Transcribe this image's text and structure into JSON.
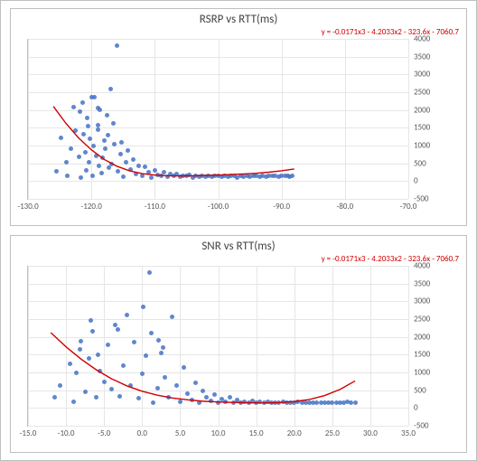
{
  "chart_data": [
    {
      "type": "scatter",
      "title": "RSRP vs RTT(ms)",
      "equation": "y = -0.0171x3 - 4.2033x2 - 323.6x - 7060.7",
      "xlabel": "",
      "ylabel": "",
      "xlim": [
        -130.0,
        -70.0
      ],
      "ylim": [
        -500,
        4000
      ],
      "xticks": [
        -130.0,
        -120.0,
        -110.0,
        -100.0,
        -90.0,
        -80.0,
        -70.0
      ],
      "yticks": [
        -500,
        0,
        500,
        1000,
        1500,
        2000,
        2500,
        3000,
        3500,
        4000
      ],
      "points": [
        [
          -125.5,
          280
        ],
        [
          -124.0,
          520
        ],
        [
          -124.8,
          1210
        ],
        [
          -123.8,
          160
        ],
        [
          -123.2,
          900
        ],
        [
          -122.5,
          1420
        ],
        [
          -122.0,
          680
        ],
        [
          -121.8,
          1950
        ],
        [
          -121.6,
          110
        ],
        [
          -121.2,
          1320
        ],
        [
          -121.0,
          820
        ],
        [
          -120.8,
          310
        ],
        [
          -120.6,
          1780
        ],
        [
          -120.4,
          520
        ],
        [
          -120.2,
          1180
        ],
        [
          -120.0,
          2350
        ],
        [
          -119.8,
          140
        ],
        [
          -119.6,
          980
        ],
        [
          -119.2,
          700
        ],
        [
          -119.0,
          1450
        ],
        [
          -118.8,
          430
        ],
        [
          -118.6,
          2000
        ],
        [
          -118.4,
          230
        ],
        [
          -118.2,
          660
        ],
        [
          -118.0,
          1150
        ],
        [
          -117.8,
          900
        ],
        [
          -117.6,
          1850
        ],
        [
          -117.2,
          380
        ],
        [
          -117.0,
          2600
        ],
        [
          -116.8,
          480
        ],
        [
          -116.4,
          1040
        ],
        [
          -116.0,
          3820
        ],
        [
          -115.8,
          280
        ],
        [
          -115.4,
          760
        ],
        [
          -115.0,
          120
        ],
        [
          -114.6,
          520
        ],
        [
          -114.2,
          870
        ],
        [
          -113.8,
          330
        ],
        [
          -113.4,
          600
        ],
        [
          -113.0,
          190
        ],
        [
          -112.5,
          420
        ],
        [
          -112.0,
          150
        ],
        [
          -111.5,
          390
        ],
        [
          -111.0,
          250
        ],
        [
          -110.5,
          110
        ],
        [
          -110.0,
          310
        ],
        [
          -109.5,
          180
        ],
        [
          -109.0,
          140
        ],
        [
          -108.5,
          250
        ],
        [
          -108.0,
          130
        ],
        [
          -107.5,
          210
        ],
        [
          -107.0,
          150
        ],
        [
          -106.5,
          190
        ],
        [
          -106.0,
          120
        ],
        [
          -105.5,
          160
        ],
        [
          -105.0,
          140
        ],
        [
          -104.5,
          170
        ],
        [
          -104.0,
          110
        ],
        [
          -103.5,
          150
        ],
        [
          -103.0,
          130
        ],
        [
          -102.5,
          160
        ],
        [
          -102.0,
          120
        ],
        [
          -101.5,
          150
        ],
        [
          -101.0,
          130
        ],
        [
          -100.5,
          140
        ],
        [
          -100.0,
          150
        ],
        [
          -99.5,
          120
        ],
        [
          -99.0,
          150
        ],
        [
          -98.5,
          130
        ],
        [
          -98.0,
          160
        ],
        [
          -97.5,
          140
        ],
        [
          -97.0,
          110
        ],
        [
          -96.5,
          150
        ],
        [
          -96.0,
          130
        ],
        [
          -95.5,
          160
        ],
        [
          -95.0,
          120
        ],
        [
          -94.5,
          150
        ],
        [
          -94.0,
          140
        ],
        [
          -93.5,
          130
        ],
        [
          -93.0,
          150
        ],
        [
          -92.5,
          120
        ],
        [
          -92.0,
          160
        ],
        [
          -91.5,
          140
        ],
        [
          -91.0,
          150
        ],
        [
          -90.5,
          120
        ],
        [
          -90.0,
          150
        ],
        [
          -89.5,
          140
        ],
        [
          -89.0,
          150
        ],
        [
          -88.7,
          130
        ],
        [
          -88.3,
          150
        ],
        [
          -119.5,
          2350
        ],
        [
          -118.9,
          1570
        ],
        [
          -117.4,
          1280
        ],
        [
          -116.6,
          1620
        ],
        [
          -115.2,
          1090
        ],
        [
          -121.4,
          2200
        ],
        [
          -120.5,
          1550
        ],
        [
          -119.0,
          2050
        ],
        [
          -122.8,
          2080
        ]
      ],
      "fit_curve": [
        [
          -126,
          2100
        ],
        [
          -124,
          1620
        ],
        [
          -122,
          1210
        ],
        [
          -120,
          880
        ],
        [
          -118,
          610
        ],
        [
          -116,
          420
        ],
        [
          -114,
          290
        ],
        [
          -112,
          210
        ],
        [
          -110,
          170
        ],
        [
          -108,
          150
        ],
        [
          -106,
          145
        ],
        [
          -104,
          150
        ],
        [
          -102,
          160
        ],
        [
          -100,
          170
        ],
        [
          -98,
          185
        ],
        [
          -96,
          200
        ],
        [
          -94,
          220
        ],
        [
          -92,
          250
        ],
        [
          -90,
          290
        ],
        [
          -88,
          340
        ]
      ]
    },
    {
      "type": "scatter",
      "title": "SNR vs RTT(ms)",
      "equation": "y = -0.0171x3 - 4.2033x2 - 323.6x - 7060.7",
      "xlabel": "",
      "ylabel": "",
      "xlim": [
        -15.0,
        35.0
      ],
      "ylim": [
        -500,
        4000
      ],
      "xticks": [
        -15.0,
        -10.0,
        -5.0,
        0.0,
        5.0,
        10.0,
        15.0,
        20.0,
        25.0,
        30.0,
        35.0
      ],
      "yticks": [
        -500,
        0,
        500,
        1000,
        1500,
        2000,
        2500,
        3000,
        3500,
        4000
      ],
      "points": [
        [
          -11.5,
          290
        ],
        [
          -10.8,
          620
        ],
        [
          -9.5,
          1250
        ],
        [
          -9.0,
          180
        ],
        [
          -8.6,
          980
        ],
        [
          -8.0,
          1880
        ],
        [
          -7.5,
          450
        ],
        [
          -7.0,
          1400
        ],
        [
          -6.5,
          2150
        ],
        [
          -6.0,
          290
        ],
        [
          -5.5,
          1050
        ],
        [
          -5.0,
          730
        ],
        [
          -4.5,
          1780
        ],
        [
          -4.0,
          520
        ],
        [
          -3.5,
          2340
        ],
        [
          -3.0,
          330
        ],
        [
          -2.5,
          1200
        ],
        [
          -2.0,
          2620
        ],
        [
          -1.5,
          640
        ],
        [
          -1.0,
          1850
        ],
        [
          -0.5,
          280
        ],
        [
          0.0,
          970
        ],
        [
          0.5,
          1470
        ],
        [
          1.0,
          3820
        ],
        [
          1.5,
          140
        ],
        [
          2.0,
          560
        ],
        [
          2.5,
          1550
        ],
        [
          3.0,
          860
        ],
        [
          3.5,
          300
        ],
        [
          4.0,
          2560
        ],
        [
          4.5,
          640
        ],
        [
          5.0,
          180
        ],
        [
          5.5,
          1150
        ],
        [
          6.0,
          410
        ],
        [
          6.5,
          220
        ],
        [
          7.0,
          700
        ],
        [
          7.5,
          150
        ],
        [
          8.0,
          470
        ],
        [
          8.5,
          300
        ],
        [
          9.0,
          200
        ],
        [
          9.5,
          380
        ],
        [
          10.0,
          160
        ],
        [
          10.5,
          250
        ],
        [
          11.0,
          170
        ],
        [
          11.5,
          310
        ],
        [
          12.0,
          150
        ],
        [
          12.5,
          220
        ],
        [
          13.0,
          140
        ],
        [
          13.5,
          180
        ],
        [
          14.0,
          160
        ],
        [
          14.5,
          200
        ],
        [
          15.0,
          150
        ],
        [
          15.5,
          170
        ],
        [
          16.0,
          140
        ],
        [
          16.5,
          180
        ],
        [
          17.0,
          150
        ],
        [
          17.5,
          160
        ],
        [
          18.0,
          140
        ],
        [
          18.5,
          170
        ],
        [
          19.0,
          150
        ],
        [
          19.5,
          160
        ],
        [
          20.0,
          140
        ],
        [
          20.5,
          170
        ],
        [
          21.0,
          150
        ],
        [
          21.5,
          160
        ],
        [
          22.0,
          150
        ],
        [
          22.5,
          140
        ],
        [
          23.0,
          160
        ],
        [
          23.5,
          150
        ],
        [
          24.0,
          150
        ],
        [
          24.5,
          160
        ],
        [
          25.0,
          150
        ],
        [
          25.5,
          150
        ],
        [
          26.0,
          160
        ],
        [
          26.5,
          150
        ],
        [
          27.0,
          180
        ],
        [
          27.5,
          150
        ],
        [
          28.0,
          160
        ],
        [
          -6.8,
          2450
        ],
        [
          -3.2,
          2200
        ],
        [
          0.2,
          2850
        ],
        [
          1.2,
          2100
        ],
        [
          2.2,
          1900
        ],
        [
          2.8,
          1700
        ],
        [
          -8.2,
          1650
        ],
        [
          -5.8,
          1500
        ]
      ],
      "fit_curve": [
        [
          -12,
          2120
        ],
        [
          -10,
          1720
        ],
        [
          -8,
          1370
        ],
        [
          -6,
          1070
        ],
        [
          -4,
          820
        ],
        [
          -2,
          620
        ],
        [
          0,
          470
        ],
        [
          2,
          360
        ],
        [
          4,
          280
        ],
        [
          6,
          230
        ],
        [
          8,
          190
        ],
        [
          10,
          170
        ],
        [
          12,
          155
        ],
        [
          14,
          145
        ],
        [
          16,
          140
        ],
        [
          18,
          150
        ],
        [
          20,
          180
        ],
        [
          22,
          240
        ],
        [
          24,
          350
        ],
        [
          26,
          520
        ],
        [
          28,
          760
        ]
      ]
    }
  ]
}
